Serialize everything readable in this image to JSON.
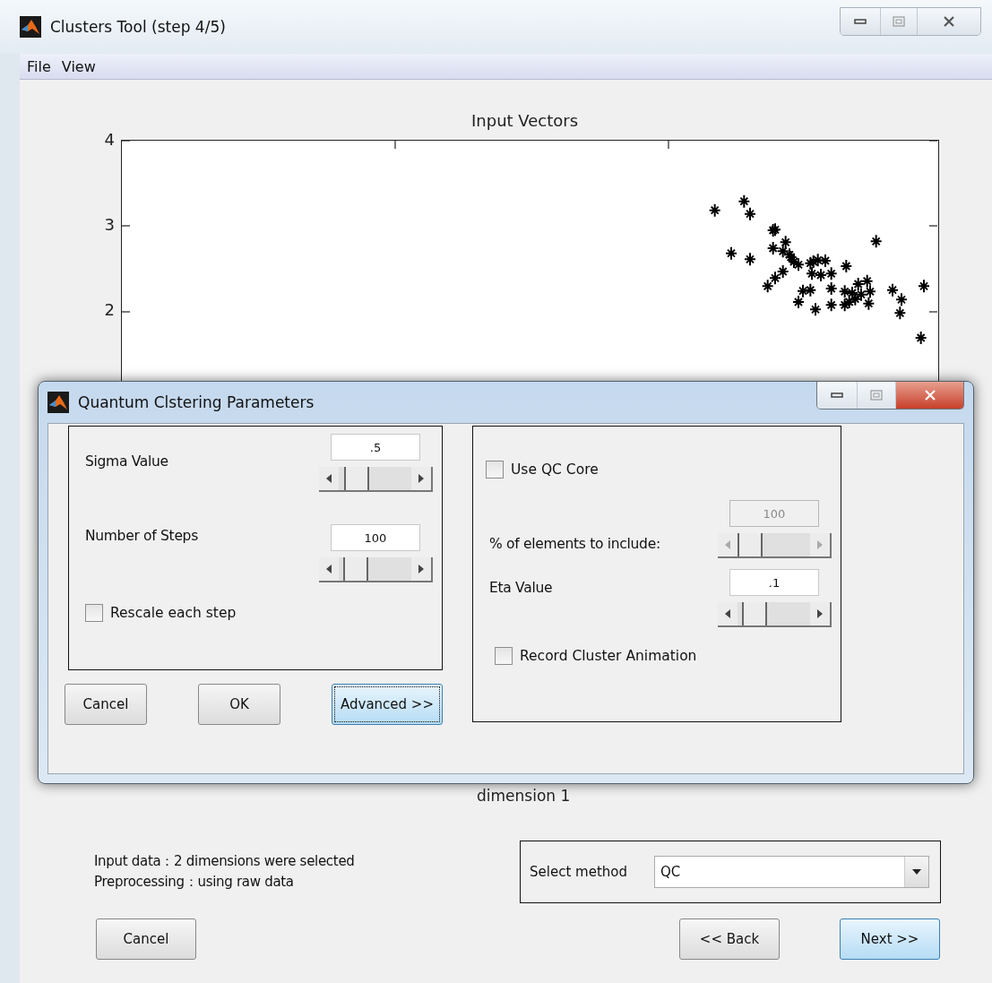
{
  "window": {
    "title": "Clusters Tool (step 4/5)"
  },
  "menu": [
    {
      "label": "File"
    },
    {
      "label": "View"
    }
  ],
  "plot": {
    "title": "Input Vectors",
    "ytick_labels": [
      "4",
      "3",
      "2"
    ],
    "xlabel": "dimension 1"
  },
  "dialog": {
    "title": "Quantum Clstering Parameters",
    "left_panel": [
      {
        "kind": "slider",
        "label": "Sigma Value",
        "value": ".5",
        "level": 0.12,
        "disabled": false
      },
      {
        "kind": "slider",
        "label": "Number of Steps",
        "value": "100",
        "level": 0.1,
        "disabled": false
      },
      {
        "kind": "checkbox",
        "label": "Rescale each step",
        "checked": false
      }
    ],
    "buttons": [
      {
        "label": "Cancel",
        "highlighted": false
      },
      {
        "label": "OK",
        "highlighted": false
      },
      {
        "label": "Advanced >>",
        "highlighted": true
      }
    ],
    "right_panel": [
      {
        "kind": "checkbox",
        "label": "Use QC Core",
        "checked": false
      },
      {
        "kind": "slider",
        "label": "% of elements to include:",
        "value": "100",
        "level": 0,
        "disabled": true
      },
      {
        "kind": "slider",
        "label": "Eta Value",
        "value": ".1",
        "level": 0.1,
        "disabled": false
      },
      {
        "kind": "checkbox",
        "label": "Record Cluster Animation",
        "checked": false
      }
    ]
  },
  "info": [
    "Input data：2 dimensions were selected",
    "Preprocessing：using raw data"
  ],
  "method": {
    "label": "Select method",
    "value": "QC"
  },
  "buttons": [
    {
      "label": "Cancel",
      "highlighted": false
    },
    {
      "label": "<< Back",
      "highlighted": false
    },
    {
      "label": "Next >>",
      "highlighted": true
    }
  ]
}
